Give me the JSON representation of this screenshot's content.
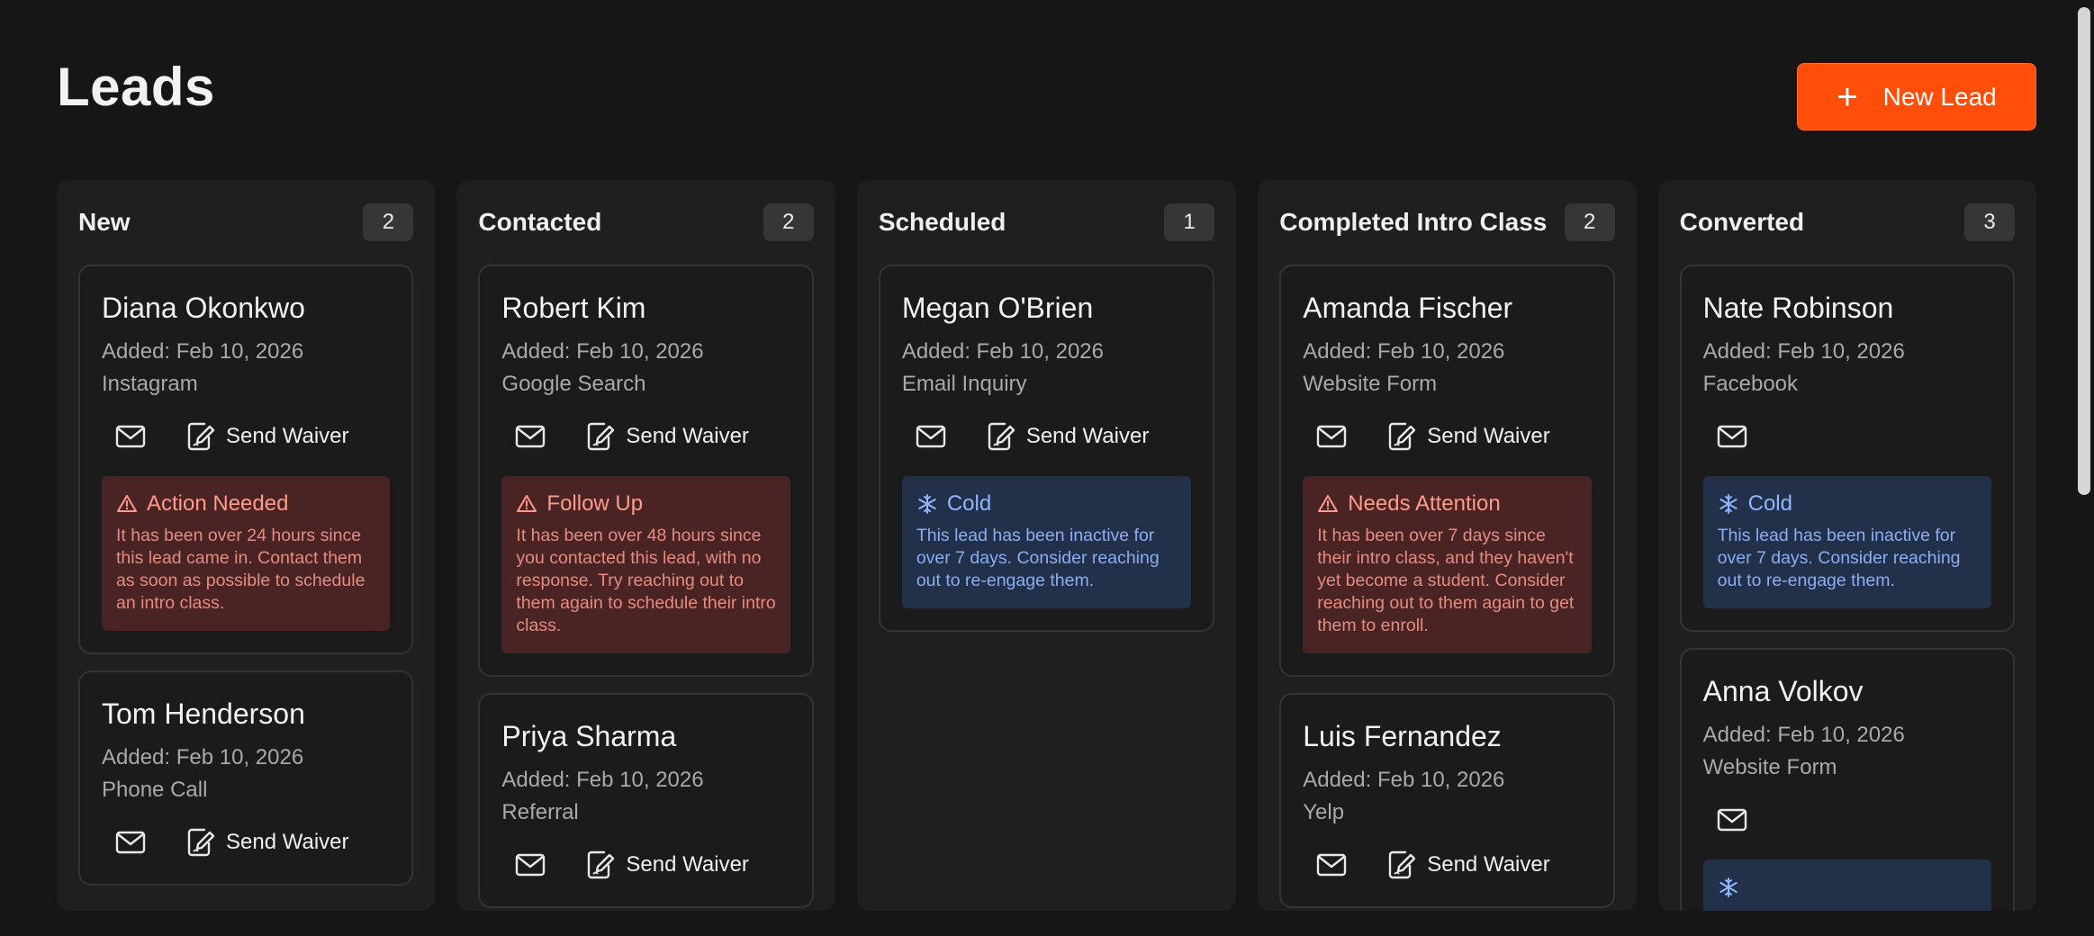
{
  "page": {
    "title": "Leads",
    "new_lead_label": "New Lead",
    "new_lead_icon": "plus-icon",
    "accent_color": "#ff4d0a"
  },
  "columns": [
    {
      "title": "New",
      "count": "2",
      "cards": [
        {
          "name": "Diana Okonkwo",
          "added": "Added: Feb 10, 2026",
          "source": "Instagram",
          "waiver_label": "Send Waiver",
          "alert": {
            "type": "warn",
            "title": "Action Needed",
            "body": "It has been over 24 hours since this lead came in. Contact them as soon as possible to schedule an intro class."
          }
        },
        {
          "name": "Tom Henderson",
          "added": "Added: Feb 10, 2026",
          "source": "Phone Call",
          "waiver_label": "Send Waiver"
        }
      ]
    },
    {
      "title": "Contacted",
      "count": "2",
      "cards": [
        {
          "name": "Robert Kim",
          "added": "Added: Feb 10, 2026",
          "source": "Google Search",
          "waiver_label": "Send Waiver",
          "alert": {
            "type": "warn",
            "title": "Follow Up",
            "body": "It has been over 48 hours since you contacted this lead, with no response. Try reaching out to them again to schedule their intro class."
          }
        },
        {
          "name": "Priya Sharma",
          "added": "Added: Feb 10, 2026",
          "source": "Referral",
          "waiver_label": "Send Waiver"
        }
      ]
    },
    {
      "title": "Scheduled",
      "count": "1",
      "cards": [
        {
          "name": "Megan O'Brien",
          "added": "Added: Feb 10, 2026",
          "source": "Email Inquiry",
          "waiver_label": "Send Waiver",
          "alert": {
            "type": "cold",
            "title": "Cold",
            "body": "This lead has been inactive for over 7 days. Consider reaching out to re-engage them."
          }
        }
      ]
    },
    {
      "title": "Completed Intro Class",
      "count": "2",
      "cards": [
        {
          "name": "Amanda Fischer",
          "added": "Added: Feb 10, 2026",
          "source": "Website Form",
          "waiver_label": "Send Waiver",
          "alert": {
            "type": "warn",
            "title": "Needs Attention",
            "body": "It has been over 7 days since their intro class, and they haven't yet become a student. Consider reaching out to them again to get them to enroll."
          }
        },
        {
          "name": "Luis Fernandez",
          "added": "Added: Feb 10, 2026",
          "source": "Yelp",
          "waiver_label": "Send Waiver"
        }
      ]
    },
    {
      "title": "Converted",
      "count": "3",
      "cards": [
        {
          "name": "Nate Robinson",
          "added": "Added: Feb 10, 2026",
          "source": "Facebook",
          "alert": {
            "type": "cold",
            "title": "Cold",
            "body": "This lead has been inactive for over 7 days. Consider reaching out to re-engage them."
          }
        },
        {
          "name": "Anna Volkov",
          "added": "Added: Feb 10, 2026",
          "source": "Website Form",
          "alert": {
            "type": "cold",
            "title": "",
            "body": ""
          }
        }
      ]
    }
  ]
}
